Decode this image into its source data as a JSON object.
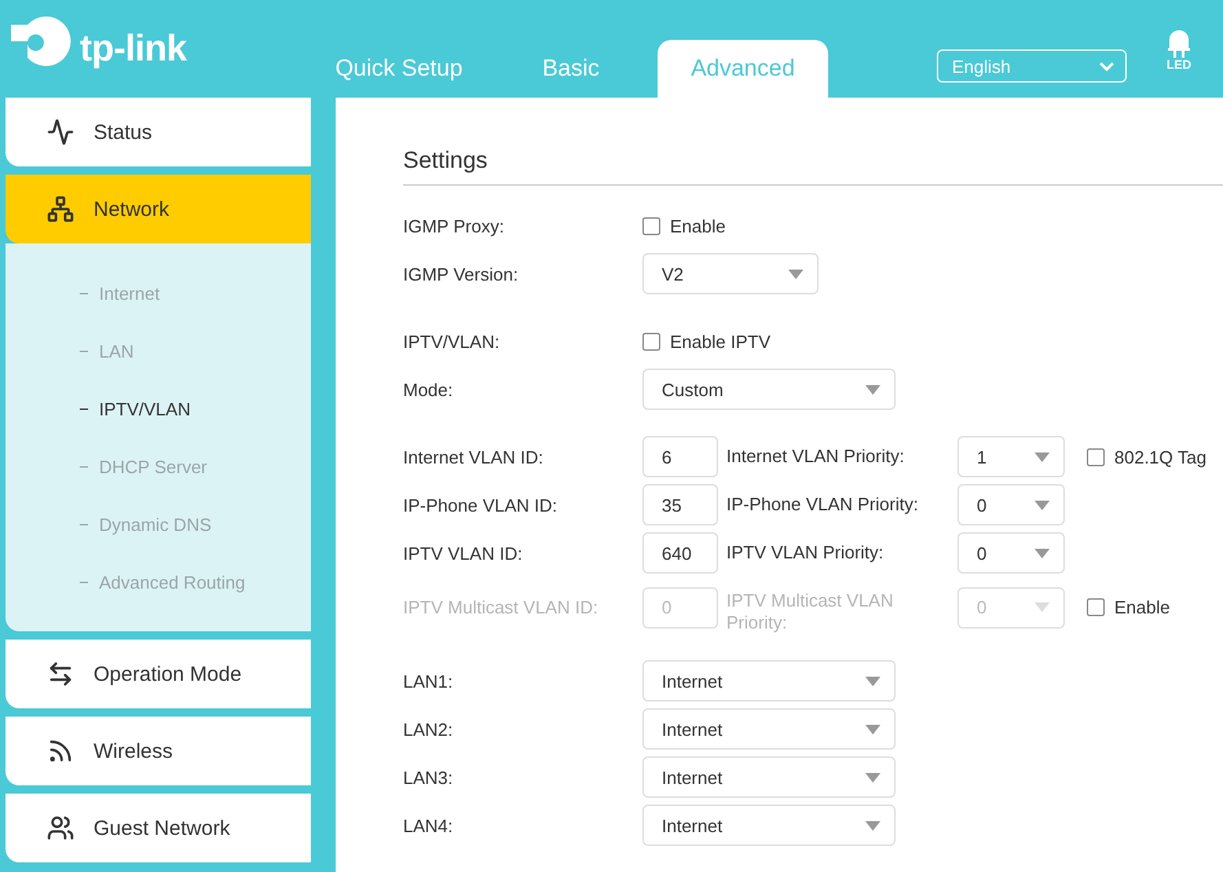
{
  "header": {
    "logo_text": "tp-link",
    "tabs": [
      {
        "label": "Quick Setup",
        "selected": false
      },
      {
        "label": "Basic",
        "selected": false
      },
      {
        "label": "Advanced",
        "selected": true
      }
    ],
    "language": "English",
    "led_label": "LED"
  },
  "sidebar": {
    "items": [
      {
        "label": "Status",
        "selected": false
      },
      {
        "label": "Network",
        "selected": true,
        "children": [
          {
            "label": "Internet",
            "selected": false
          },
          {
            "label": "LAN",
            "selected": false
          },
          {
            "label": "IPTV/VLAN",
            "selected": true
          },
          {
            "label": "DHCP Server",
            "selected": false
          },
          {
            "label": "Dynamic DNS",
            "selected": false
          },
          {
            "label": "Advanced Routing",
            "selected": false
          }
        ]
      },
      {
        "label": "Operation Mode",
        "selected": false
      },
      {
        "label": "Wireless",
        "selected": false
      },
      {
        "label": "Guest Network",
        "selected": false
      }
    ]
  },
  "settings": {
    "title": "Settings",
    "groups": [
      [
        {
          "kind": "checkbox",
          "label": "IGMP Proxy:",
          "option": "Enable",
          "checked": false
        },
        {
          "kind": "short_select",
          "label": "IGMP Version:",
          "value": "V2"
        }
      ],
      [
        {
          "kind": "checkbox",
          "label": "IPTV/VLAN:",
          "option": "Enable IPTV",
          "checked": false
        },
        {
          "kind": "select",
          "label": "Mode:",
          "value": "Custom"
        }
      ],
      [
        {
          "kind": "vlan",
          "label": "Internet VLAN ID:",
          "id": "6",
          "priority_label": "Internet VLAN Priority:",
          "priority": "1",
          "disabled": false,
          "tag": {
            "label": "802.1Q Tag",
            "checked": false
          }
        },
        {
          "kind": "vlan",
          "label": "IP-Phone VLAN ID:",
          "id": "35",
          "priority_label": "IP-Phone VLAN Priority:",
          "priority": "0",
          "disabled": false
        },
        {
          "kind": "vlan",
          "label": "IPTV VLAN ID:",
          "id": "640",
          "priority_label": "IPTV VLAN Priority:",
          "priority": "0",
          "disabled": false
        },
        {
          "kind": "vlan",
          "label": "IPTV Multicast VLAN ID:",
          "id": "0",
          "priority_label": "IPTV Multicast VLAN Priority:",
          "priority": "0",
          "disabled": true,
          "tag": {
            "label": "Enable",
            "checked": false
          }
        }
      ],
      [
        {
          "kind": "select",
          "label": "LAN1:",
          "value": "Internet"
        },
        {
          "kind": "select",
          "label": "LAN2:",
          "value": "Internet"
        },
        {
          "kind": "select",
          "label": "LAN3:",
          "value": "Internet"
        },
        {
          "kind": "select",
          "label": "LAN4:",
          "value": "Internet"
        }
      ]
    ]
  }
}
